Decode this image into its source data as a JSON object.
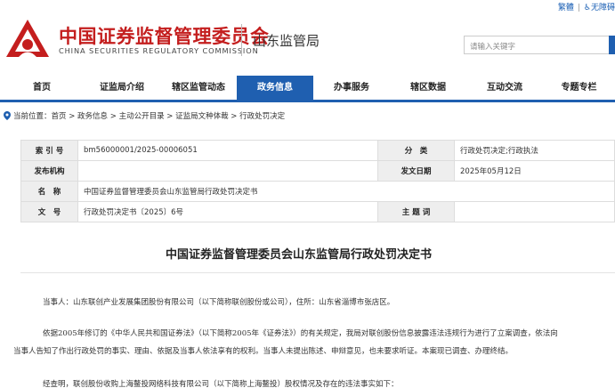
{
  "topbar": {
    "traditional": "繁體",
    "accessibility": "无障碍"
  },
  "header": {
    "org_cn": "中国证券监督管理委员会",
    "org_en": "CHINA SECURITIES REGULATORY COMMISSION",
    "bureau": "山东监管局",
    "brand_color": "#c41e1e"
  },
  "search": {
    "placeholder": "请输入关键字"
  },
  "nav": {
    "accent": "#1f5fb0",
    "items": [
      {
        "label": "首页"
      },
      {
        "label": "证监局介绍"
      },
      {
        "label": "辖区监管动态"
      },
      {
        "label": "政务信息",
        "active": true
      },
      {
        "label": "办事服务"
      },
      {
        "label": "辖区数据"
      },
      {
        "label": "互动交流"
      },
      {
        "label": "专题专栏"
      }
    ]
  },
  "breadcrumb": {
    "prefix": "当前位置：",
    "path": "首页 > 政务信息 > 主动公开目录 > 证监局文种体裁 > 行政处罚决定"
  },
  "meta": {
    "index_label": "索 引 号",
    "index_value": "bm56000001/2025-00006051",
    "category_label": "分　类",
    "category_value": "行政处罚决定;行政执法",
    "issuer_label": "发布机构",
    "issuer_value": "",
    "date_label": "发文日期",
    "date_value": "2025年05月12日",
    "name_label": "名　称",
    "name_value": "中国证券监督管理委员会山东监管局行政处罚决定书",
    "docno_label": "文　号",
    "docno_value": "行政处罚决定书〔2025〕6号",
    "topic_label": "主 题 词",
    "topic_value": ""
  },
  "document": {
    "title": "中国证券监督管理委员会山东监管局行政处罚决定书",
    "p1": "当事人：山东联创产业发展集团股份有限公司（以下简称联创股份或公司），住所：山东省淄博市张店区。",
    "p2_line1": "依据2005年修订的《中华人民共和国证券法》（以下简称2005年《证券法》）的有关规定，我局对联创股份信息披露违法违规行为进行了立案调查，依法向",
    "p2_line2": "当事人告知了作出行政处罚的事实、理由、依据及当事人依法享有的权利。当事人未提出陈述、申辩意见，也未要求听证。本案现已调查、办理终结。",
    "p3": "经查明，联创股份收购上海鳌投网络科技有限公司（以下简称上海鳌投）股权情况及存在的违法事实如下："
  }
}
